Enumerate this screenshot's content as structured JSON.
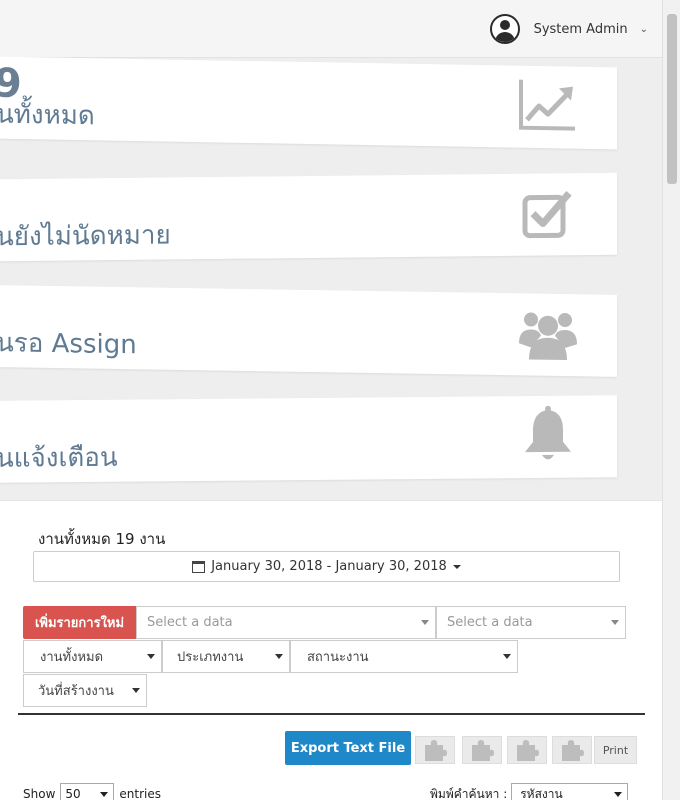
{
  "header": {
    "user_name": "System Admin"
  },
  "stats": [
    {
      "number": "9",
      "label": "นทั้งหมด",
      "icon": "line-chart-icon"
    },
    {
      "number": "",
      "label": "นยังไม่นัดหมาย",
      "icon": "checkbox-icon"
    },
    {
      "number": "",
      "label": "นรอ Assign",
      "icon": "users-icon"
    },
    {
      "number": "",
      "label": "นแจ้งเตือน",
      "icon": "bell-icon"
    }
  ],
  "panel": {
    "title": "งานทั้งหมด 19 งาน",
    "date_range": "January 30, 2018 - January 30, 2018",
    "add_button": "เพิ่มรายการใหม่",
    "select1_placeholder": "Select a data",
    "select2_placeholder": "Select a data",
    "filter_all": "งานทั้งหมด",
    "filter_type": "ประเภทงาน",
    "filter_status": "สถานะงาน",
    "filter_created": "วันที่สร้างงาน",
    "export_button": "Export Text File",
    "print_button": "Print",
    "show_label": "Show",
    "page_length": "50",
    "entries_label": "entries",
    "search_label": "พิมพ์คำค้นหา :",
    "search_field": "รหัสงาน"
  },
  "colors": {
    "danger": "#d9534f",
    "primary": "#1e88c8",
    "stat_text": "#5f7a93",
    "stat_icon": "#b9b9b9"
  }
}
